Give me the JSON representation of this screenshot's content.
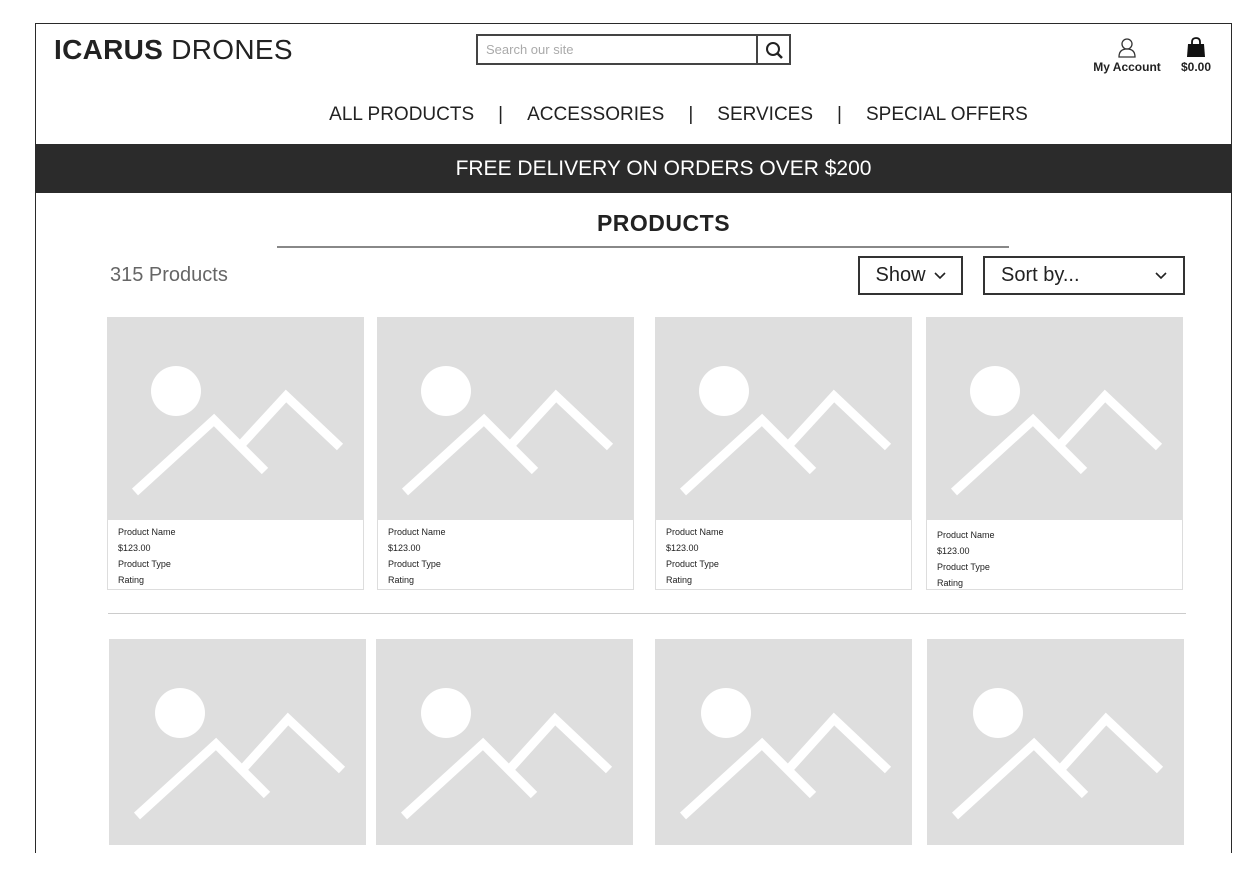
{
  "header": {
    "logo_bold": "ICARUS",
    "logo_light": "DRONES",
    "search_placeholder": "Search our site",
    "account_label": "My Account",
    "cart_total": "$0.00"
  },
  "nav": {
    "items": [
      "ALL PRODUCTS",
      "ACCESSORIES",
      "SERVICES",
      "SPECIAL OFFERS"
    ],
    "separator": "|"
  },
  "banner": {
    "text": "FREE DELIVERY ON ORDERS OVER $200"
  },
  "main": {
    "title": "PRODUCTS",
    "count": "315 Products",
    "show_label": "Show",
    "sort_label": "Sort by..."
  },
  "products": [
    {
      "name": "Product Name",
      "price": "$123.00",
      "type": "Product Type",
      "rating": "Rating"
    },
    {
      "name": "Product Name",
      "price": "$123.00",
      "type": "Product Type",
      "rating": "Rating"
    },
    {
      "name": "Product Name",
      "price": "$123.00",
      "type": "Product Type",
      "rating": "Rating"
    },
    {
      "name": "Product Name",
      "price": "$123.00",
      "type": "Product Type",
      "rating": "Rating"
    }
  ],
  "icons": {
    "search": "search-icon",
    "account": "user-icon",
    "cart": "shopping-bag-icon",
    "chevron": "chevron-down-icon",
    "placeholder": "image-placeholder-icon"
  }
}
